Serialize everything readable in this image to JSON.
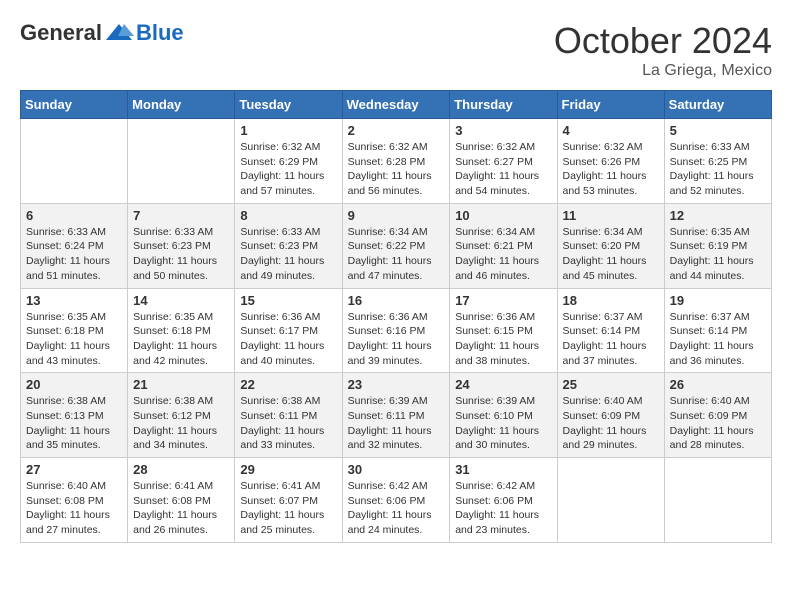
{
  "header": {
    "logo": {
      "general": "General",
      "blue": "Blue"
    },
    "title": "October 2024",
    "location": "La Griega, Mexico"
  },
  "calendar": {
    "days_of_week": [
      "Sunday",
      "Monday",
      "Tuesday",
      "Wednesday",
      "Thursday",
      "Friday",
      "Saturday"
    ],
    "weeks": [
      [
        {
          "day": "",
          "info": ""
        },
        {
          "day": "",
          "info": ""
        },
        {
          "day": "1",
          "info": "Sunrise: 6:32 AM\nSunset: 6:29 PM\nDaylight: 11 hours and 57 minutes."
        },
        {
          "day": "2",
          "info": "Sunrise: 6:32 AM\nSunset: 6:28 PM\nDaylight: 11 hours and 56 minutes."
        },
        {
          "day": "3",
          "info": "Sunrise: 6:32 AM\nSunset: 6:27 PM\nDaylight: 11 hours and 54 minutes."
        },
        {
          "day": "4",
          "info": "Sunrise: 6:32 AM\nSunset: 6:26 PM\nDaylight: 11 hours and 53 minutes."
        },
        {
          "day": "5",
          "info": "Sunrise: 6:33 AM\nSunset: 6:25 PM\nDaylight: 11 hours and 52 minutes."
        }
      ],
      [
        {
          "day": "6",
          "info": "Sunrise: 6:33 AM\nSunset: 6:24 PM\nDaylight: 11 hours and 51 minutes."
        },
        {
          "day": "7",
          "info": "Sunrise: 6:33 AM\nSunset: 6:23 PM\nDaylight: 11 hours and 50 minutes."
        },
        {
          "day": "8",
          "info": "Sunrise: 6:33 AM\nSunset: 6:23 PM\nDaylight: 11 hours and 49 minutes."
        },
        {
          "day": "9",
          "info": "Sunrise: 6:34 AM\nSunset: 6:22 PM\nDaylight: 11 hours and 47 minutes."
        },
        {
          "day": "10",
          "info": "Sunrise: 6:34 AM\nSunset: 6:21 PM\nDaylight: 11 hours and 46 minutes."
        },
        {
          "day": "11",
          "info": "Sunrise: 6:34 AM\nSunset: 6:20 PM\nDaylight: 11 hours and 45 minutes."
        },
        {
          "day": "12",
          "info": "Sunrise: 6:35 AM\nSunset: 6:19 PM\nDaylight: 11 hours and 44 minutes."
        }
      ],
      [
        {
          "day": "13",
          "info": "Sunrise: 6:35 AM\nSunset: 6:18 PM\nDaylight: 11 hours and 43 minutes."
        },
        {
          "day": "14",
          "info": "Sunrise: 6:35 AM\nSunset: 6:18 PM\nDaylight: 11 hours and 42 minutes."
        },
        {
          "day": "15",
          "info": "Sunrise: 6:36 AM\nSunset: 6:17 PM\nDaylight: 11 hours and 40 minutes."
        },
        {
          "day": "16",
          "info": "Sunrise: 6:36 AM\nSunset: 6:16 PM\nDaylight: 11 hours and 39 minutes."
        },
        {
          "day": "17",
          "info": "Sunrise: 6:36 AM\nSunset: 6:15 PM\nDaylight: 11 hours and 38 minutes."
        },
        {
          "day": "18",
          "info": "Sunrise: 6:37 AM\nSunset: 6:14 PM\nDaylight: 11 hours and 37 minutes."
        },
        {
          "day": "19",
          "info": "Sunrise: 6:37 AM\nSunset: 6:14 PM\nDaylight: 11 hours and 36 minutes."
        }
      ],
      [
        {
          "day": "20",
          "info": "Sunrise: 6:38 AM\nSunset: 6:13 PM\nDaylight: 11 hours and 35 minutes."
        },
        {
          "day": "21",
          "info": "Sunrise: 6:38 AM\nSunset: 6:12 PM\nDaylight: 11 hours and 34 minutes."
        },
        {
          "day": "22",
          "info": "Sunrise: 6:38 AM\nSunset: 6:11 PM\nDaylight: 11 hours and 33 minutes."
        },
        {
          "day": "23",
          "info": "Sunrise: 6:39 AM\nSunset: 6:11 PM\nDaylight: 11 hours and 32 minutes."
        },
        {
          "day": "24",
          "info": "Sunrise: 6:39 AM\nSunset: 6:10 PM\nDaylight: 11 hours and 30 minutes."
        },
        {
          "day": "25",
          "info": "Sunrise: 6:40 AM\nSunset: 6:09 PM\nDaylight: 11 hours and 29 minutes."
        },
        {
          "day": "26",
          "info": "Sunrise: 6:40 AM\nSunset: 6:09 PM\nDaylight: 11 hours and 28 minutes."
        }
      ],
      [
        {
          "day": "27",
          "info": "Sunrise: 6:40 AM\nSunset: 6:08 PM\nDaylight: 11 hours and 27 minutes."
        },
        {
          "day": "28",
          "info": "Sunrise: 6:41 AM\nSunset: 6:08 PM\nDaylight: 11 hours and 26 minutes."
        },
        {
          "day": "29",
          "info": "Sunrise: 6:41 AM\nSunset: 6:07 PM\nDaylight: 11 hours and 25 minutes."
        },
        {
          "day": "30",
          "info": "Sunrise: 6:42 AM\nSunset: 6:06 PM\nDaylight: 11 hours and 24 minutes."
        },
        {
          "day": "31",
          "info": "Sunrise: 6:42 AM\nSunset: 6:06 PM\nDaylight: 11 hours and 23 minutes."
        },
        {
          "day": "",
          "info": ""
        },
        {
          "day": "",
          "info": ""
        }
      ]
    ]
  }
}
